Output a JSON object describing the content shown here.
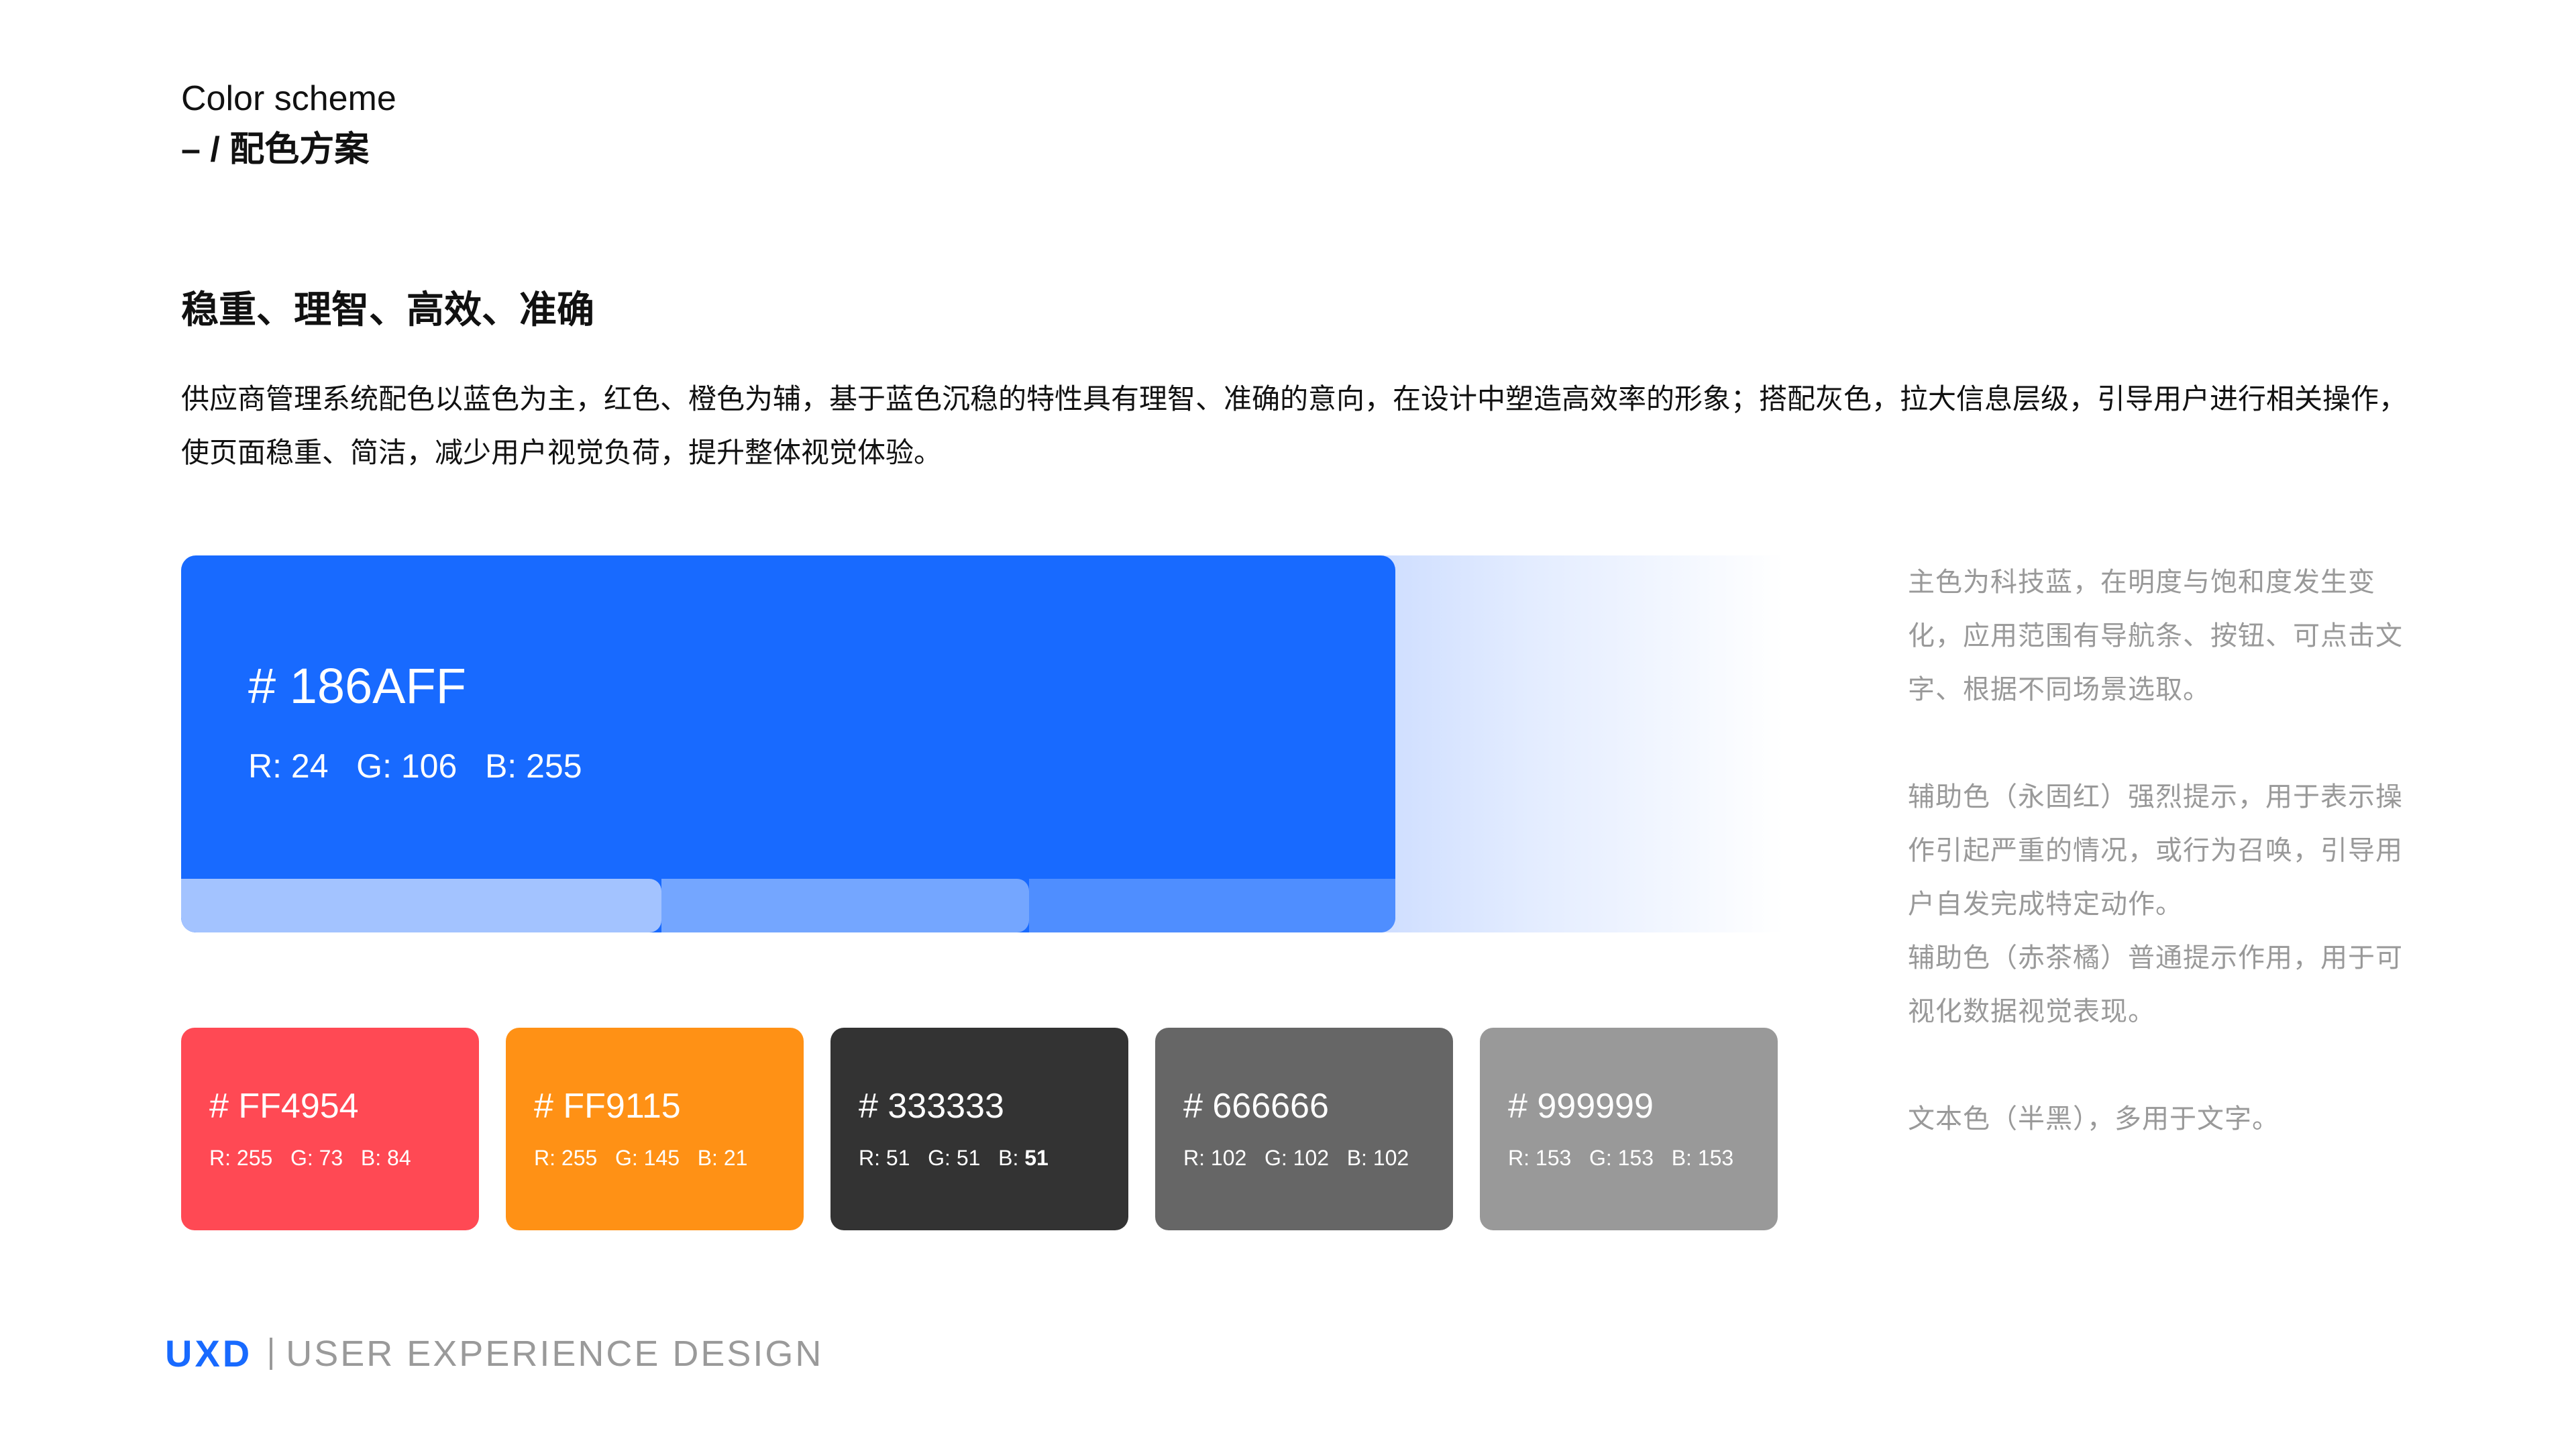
{
  "header": {
    "title_en": "Color scheme",
    "title_cn": "– / 配色方案"
  },
  "section": {
    "subtitle": "稳重、理智、高效、准确",
    "description": "供应商管理系统配色以蓝色为主，红色、橙色为辅，基于蓝色沉稳的特性具有理智、准确的意向，在设计中塑造高效率的形象；搭配灰色，拉大信息层级，引导用户进行相关操作，使页面稳重、简洁，减少用户视觉负荷，提升整体视觉体验。"
  },
  "primary": {
    "hex_label": "# 186AFF",
    "rgb_label": "R: 24   G: 106   B: 255",
    "color": "#186AFF",
    "tints": [
      "#A3C3FF",
      "#74A6FF",
      "#4F8EFF"
    ]
  },
  "swatches": [
    {
      "hex_label": "# FF4954",
      "r": "R: 255",
      "g": "G: 73",
      "b": "B: 84",
      "color": "#FF4954"
    },
    {
      "hex_label": "# FF9115",
      "r": "R: 255",
      "g": "G: 145",
      "b": "B: 21",
      "color": "#FF9115"
    },
    {
      "hex_label": "# 333333",
      "r": "R: 51",
      "g": "G: 51",
      "b": "B: ",
      "b_value": "51",
      "color": "#333333"
    },
    {
      "hex_label": "# 666666",
      "r": "R: 102",
      "g": "G: 102",
      "b": "B: 102",
      "color": "#666666"
    },
    {
      "hex_label": "# 999999",
      "r": "R: 153",
      "g": "G: 153",
      "b": "B: 153",
      "color": "#999999"
    }
  ],
  "notes": {
    "primary": "主色为科技蓝，在明度与饱和度发生变化，应用范围有导航条、按钮、可点击文字、根据不同场景选取。",
    "aux_red": "辅助色（永固红）强烈提示，用于表示操作引起严重的情况，或行为召唤，引导用户自发完成特定动作。",
    "aux_orange": "辅助色（赤茶橘）普通提示作用，用于可视化数据视觉表现。",
    "text": "文本色（半黑），多用于文字。"
  },
  "footer": {
    "logo_text": "UXD",
    "tagline": "USER EXPERIENCE DESIGN"
  }
}
